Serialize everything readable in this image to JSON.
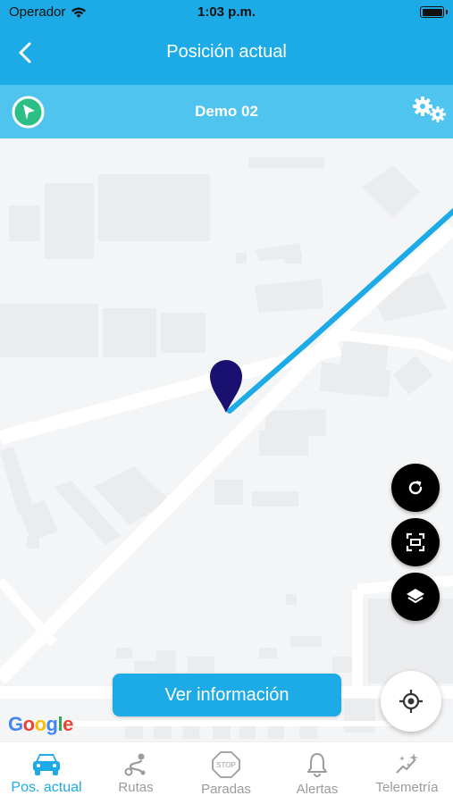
{
  "status_bar": {
    "carrier": "Operador",
    "time": "1:03 p.m.",
    "battery_level": 1.0
  },
  "header": {
    "title": "Posición actual",
    "back_icon": "chevron-left-icon"
  },
  "vehicle_bar": {
    "name": "Demo 02",
    "left_icon": "compass-arrow-icon",
    "right_icon": "gears-icon"
  },
  "map": {
    "attribution": "Google",
    "controls": [
      "refresh-icon",
      "fit-bounds-icon",
      "layers-icon"
    ],
    "locate_icon": "crosshair-icon",
    "route_color": "#1cabe6",
    "marker_color": "#1a1070"
  },
  "action_button": {
    "label": "Ver información"
  },
  "tabs": [
    {
      "label": "Pos. actual",
      "icon": "car-icon",
      "active": true
    },
    {
      "label": "Rutas",
      "icon": "route-icon",
      "active": false
    },
    {
      "label": "Paradas",
      "icon": "stop-sign-icon",
      "active": false
    },
    {
      "label": "Alertas",
      "icon": "bell-icon",
      "active": false
    },
    {
      "label": "Telemetría",
      "icon": "sparkle-chart-icon",
      "active": false
    }
  ],
  "colors": {
    "accent": "#1cabe6",
    "accent_light": "#4fc4ef",
    "inactive": "#9b9b9b"
  }
}
